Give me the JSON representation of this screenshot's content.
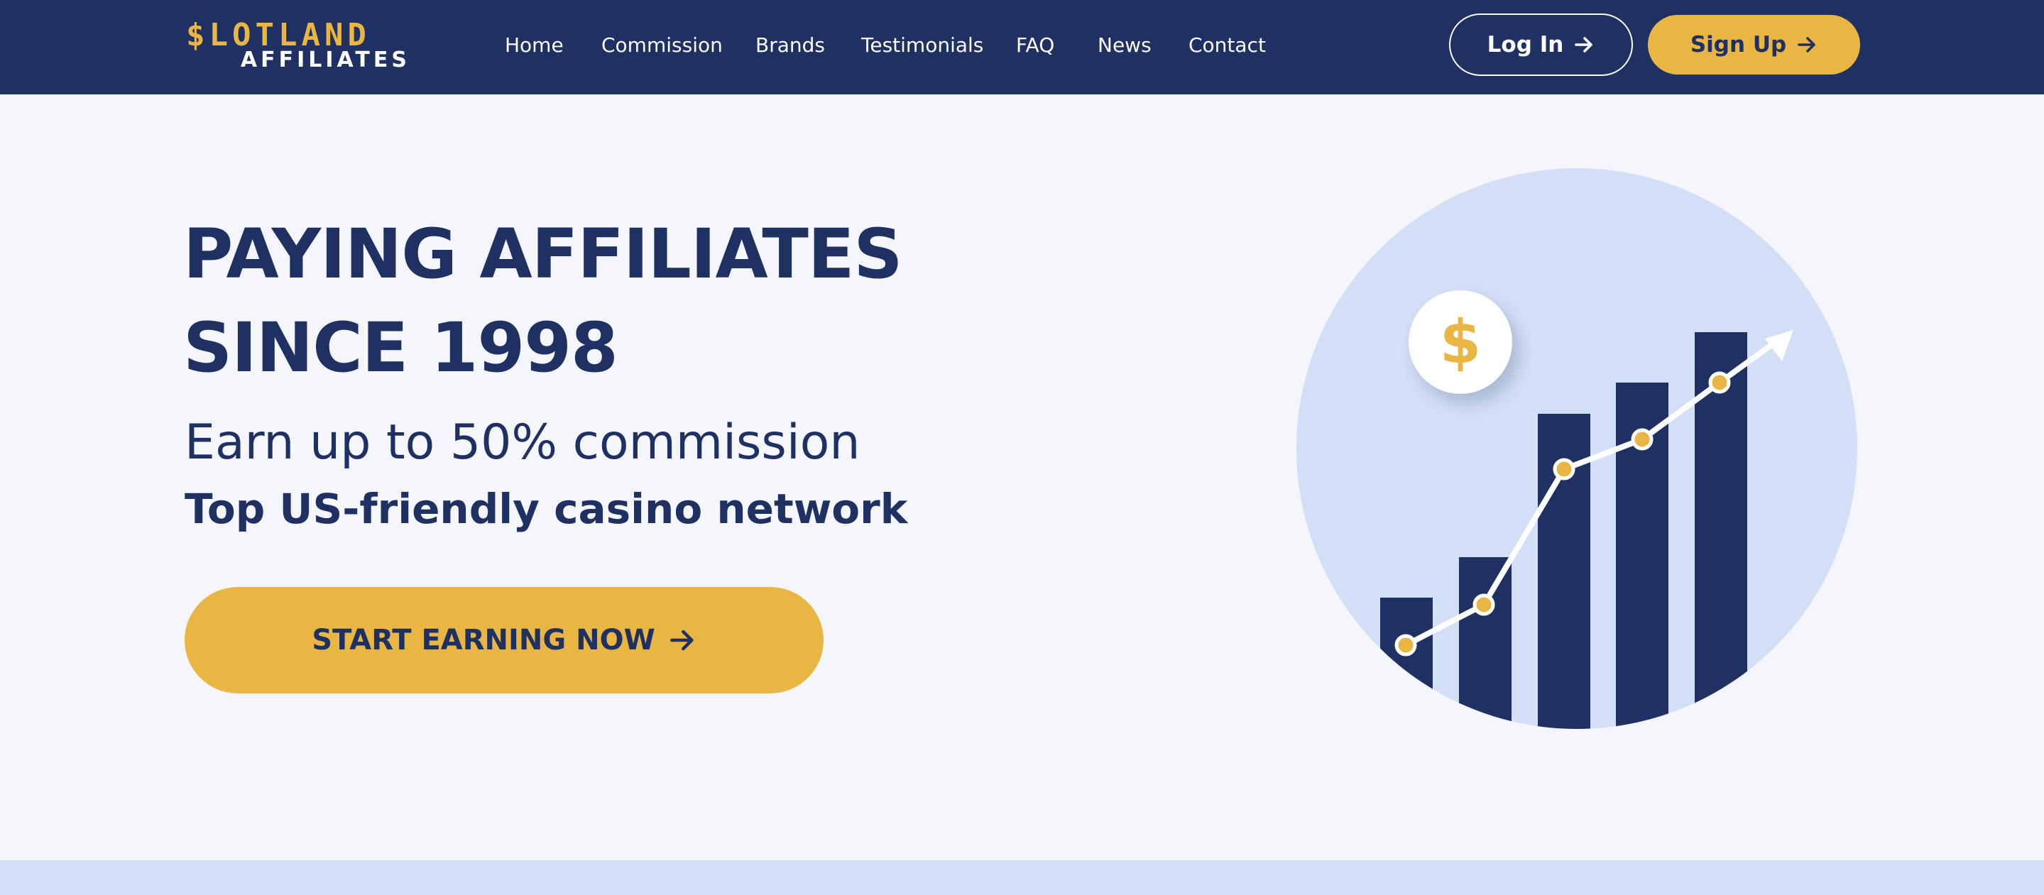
{
  "brand": {
    "logo_top": "$LOTLAND",
    "logo_bottom": "AFFILIATES",
    "accent_color": "#e9b543",
    "navy_color": "#1f3163"
  },
  "nav": {
    "links": [
      "Home",
      "Commission",
      "Brands",
      "Testimonials",
      "FAQ",
      "News",
      "Contact"
    ],
    "login_label": "Log In",
    "signup_label": "Sign Up",
    "arrow_icon": "arrow-right-icon"
  },
  "hero": {
    "title_line1": "PAYING AFFILIATES",
    "title_line2": "SINCE 1998",
    "subtitle": "Earn up to 50% commission",
    "tagline": "Top US-friendly casino network",
    "cta_label": "START EARNING NOW"
  },
  "illustration": {
    "coin_symbol": "$",
    "icon": "growth-chart-icon"
  }
}
